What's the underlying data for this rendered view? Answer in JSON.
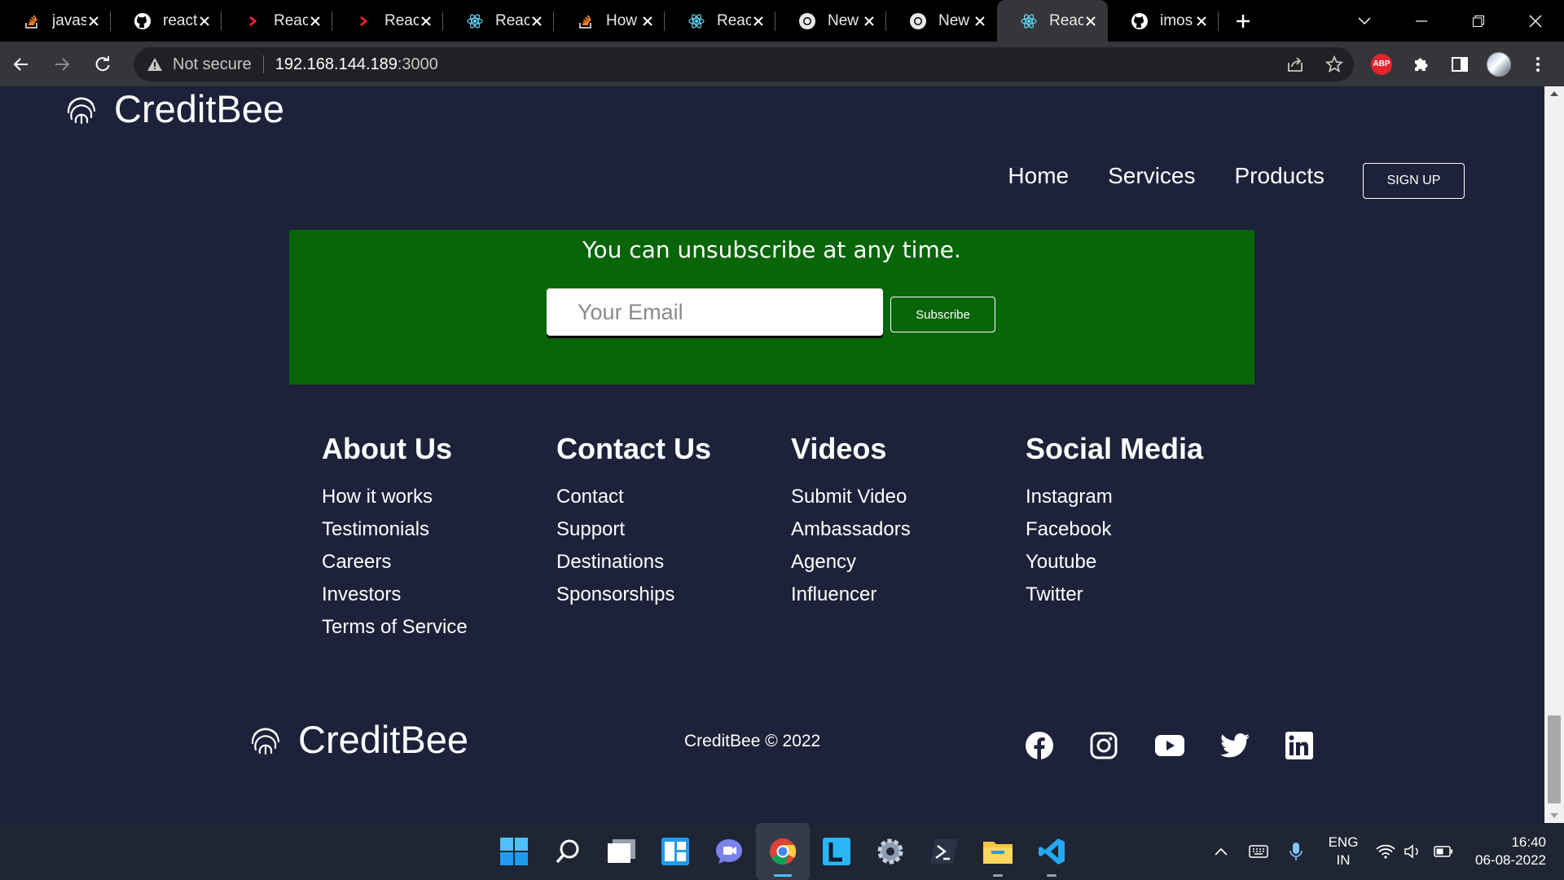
{
  "browser": {
    "tabs": [
      {
        "title": "javas",
        "icon": "stackoverflow-icon"
      },
      {
        "title": "react",
        "icon": "github-icon"
      },
      {
        "title": "React",
        "icon": "chevron-icon"
      },
      {
        "title": "React",
        "icon": "chevron-icon"
      },
      {
        "title": "React",
        "icon": "react-icon"
      },
      {
        "title": "How",
        "icon": "stackoverflow-icon"
      },
      {
        "title": "React",
        "icon": "react-icon"
      },
      {
        "title": "New",
        "icon": "chrome-icon"
      },
      {
        "title": "New",
        "icon": "chrome-icon"
      },
      {
        "title": "React",
        "icon": "react-icon",
        "active": true
      },
      {
        "title": "imos",
        "icon": "github-icon"
      }
    ],
    "security_label": "Not secure",
    "url_host": "192.168.144.189",
    "url_port": ":3000",
    "extension_abp": "ABP"
  },
  "page": {
    "brand": "CreditBee",
    "nav": {
      "home": "Home",
      "services": "Services",
      "products": "Products",
      "signup": "SIGN UP"
    },
    "subscribe": {
      "message": "You can unsubscribe at any time.",
      "email_placeholder": "Your Email",
      "button": "Subscribe",
      "bg_color": "#086508"
    },
    "footer": {
      "columns": [
        {
          "title": "About Us",
          "links": [
            "How it works",
            "Testimonials",
            "Careers",
            "Investors",
            "Terms of Service"
          ]
        },
        {
          "title": "Contact Us",
          "links": [
            "Contact",
            "Support",
            "Destinations",
            "Sponsorships"
          ]
        },
        {
          "title": "Videos",
          "links": [
            "Submit Video",
            "Ambassadors",
            "Agency",
            "Influencer"
          ]
        },
        {
          "title": "Social Media",
          "links": [
            "Instagram",
            "Facebook",
            "Youtube",
            "Twitter"
          ]
        }
      ],
      "copyright": "CreditBee © 2022",
      "social_icons": [
        "facebook-icon",
        "instagram-icon",
        "youtube-icon",
        "twitter-icon",
        "linkedin-icon"
      ]
    },
    "background": "#1d2139"
  },
  "taskbar": {
    "apps": [
      "windows-start-icon",
      "search-icon",
      "task-view-icon",
      "widgets-icon",
      "teams-chat-icon",
      "chrome-icon",
      "lens-icon",
      "settings-icon",
      "terminal-icon",
      "file-explorer-icon",
      "vscode-icon"
    ],
    "language_line1": "ENG",
    "language_line2": "IN",
    "time": "16:40",
    "date": "06-08-2022"
  }
}
